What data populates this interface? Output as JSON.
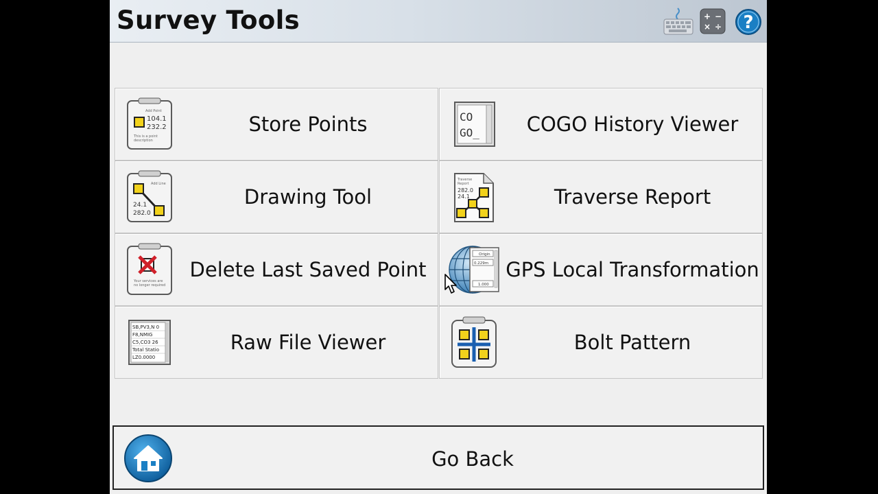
{
  "header": {
    "title": "Survey Tools",
    "icons": [
      "keyboard-icon",
      "calculator-icon",
      "help-icon"
    ]
  },
  "tiles": [
    {
      "label": "Store Points",
      "icon": "store-points-icon"
    },
    {
      "label": "COGO History Viewer",
      "icon": "cogo-history-icon"
    },
    {
      "label": "Drawing Tool",
      "icon": "drawing-tool-icon"
    },
    {
      "label": "Traverse Report",
      "icon": "traverse-report-icon"
    },
    {
      "label": "Delete Last Saved Point",
      "icon": "delete-point-icon"
    },
    {
      "label": "GPS Local Transformation",
      "icon": "gps-transformation-icon"
    },
    {
      "label": "Raw File Viewer",
      "icon": "raw-file-icon"
    },
    {
      "label": "Bolt Pattern",
      "icon": "bolt-pattern-icon"
    }
  ],
  "icon_text": {
    "store": {
      "title": "Add Point",
      "v1": "104.1",
      "v2": "232.2",
      "desc1": "This is a point",
      "desc2": "description"
    },
    "cogo": {
      "l1": "CO",
      "l2": "GO_"
    },
    "drawing": {
      "title": "Add Line",
      "v1": "24.1",
      "v2": "282.0"
    },
    "traverse": {
      "t1": "Traverse",
      "t2": "Report",
      "v1": "282.0",
      "v2": "24.1"
    },
    "delete": {
      "t1": "Your services are",
      "t2": "no longer required"
    },
    "gps": {
      "t1": "Origin",
      "t2": "0.229m",
      "t3": "1.000"
    },
    "raw": {
      "r1": "SB,PV3,N 0",
      "r2": "F8,NMIG",
      "r3": "C5,CO3 26",
      "r4": "Total Statio",
      "r5": "LZ0.0000"
    }
  },
  "footer": {
    "go_back_label": "Go Back",
    "icon": "home-icon"
  },
  "colors": {
    "accent_blue": "#1a7fc4",
    "icon_yellow": "#f2d21b",
    "delete_red": "#d0202a"
  }
}
